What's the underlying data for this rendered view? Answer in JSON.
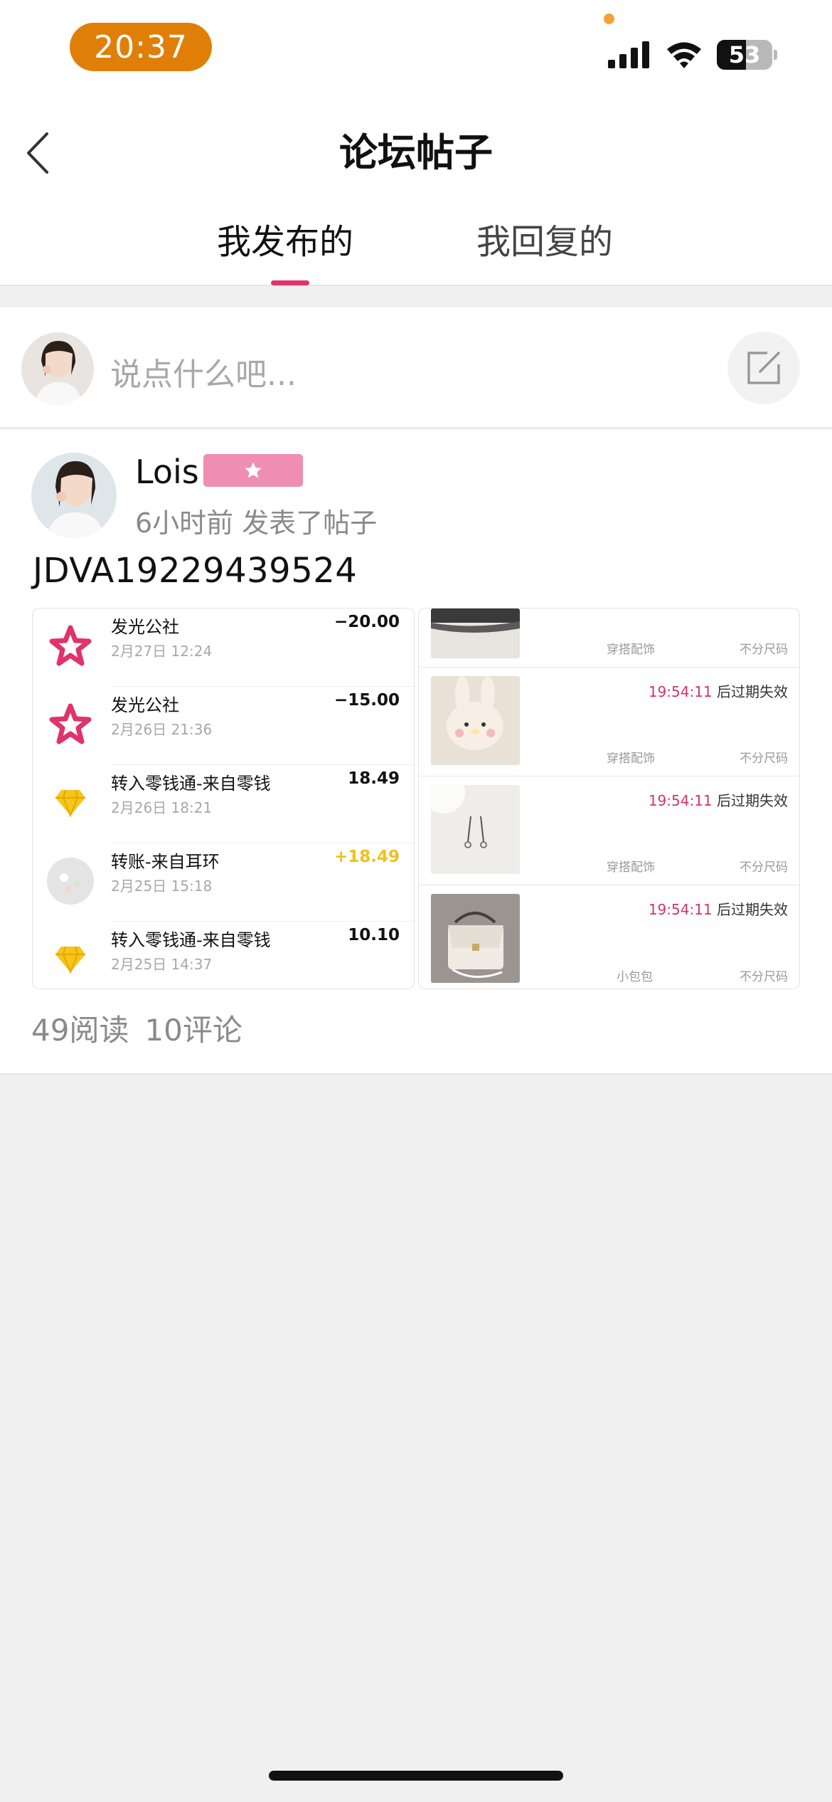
{
  "status_bar": {
    "time": "20:37",
    "battery": "53",
    "battery_level": 0.53
  },
  "nav": {
    "title": "论坛帖子",
    "back_icon": "chevron-left-icon",
    "tabs": [
      {
        "label": "我发布的",
        "active": true
      },
      {
        "label": "我回复的",
        "active": false
      }
    ],
    "accent_color": "#e0336c"
  },
  "compose": {
    "placeholder": "说点什么吧...",
    "edit_icon": "edit-icon"
  },
  "post": {
    "username": "Lois",
    "badge_icon": "star-icon",
    "meta": "6小时前 发表了帖子",
    "content": "JDVA19229439524",
    "transactions": [
      {
        "name": "发光公社",
        "date": "2月27日 12:24",
        "amount": "−20.00",
        "icon": "star-logo-icon",
        "positive": false
      },
      {
        "name": "发光公社",
        "date": "2月26日 21:36",
        "amount": "−15.00",
        "icon": "star-logo-icon",
        "positive": false
      },
      {
        "name": "转入零钱通-来自零钱",
        "date": "2月26日 18:21",
        "amount": "18.49",
        "icon": "diamond-icon",
        "positive": false
      },
      {
        "name": "转账-来自耳环",
        "date": "2月25日 15:18",
        "amount": "+18.49",
        "icon": "avatar-icon",
        "positive": true
      },
      {
        "name": "转入零钱通-来自零钱",
        "date": "2月25日 14:37",
        "amount": "10.10",
        "icon": "diamond-icon",
        "positive": false
      }
    ],
    "listings": [
      {
        "time": "",
        "time_suffix": "",
        "category": "穿搭配饰",
        "size": "不分尺码"
      },
      {
        "time": "19:54:11",
        "time_suffix": " 后过期失效",
        "category": "穿搭配饰",
        "size": "不分尺码"
      },
      {
        "time": "19:54:11",
        "time_suffix": " 后过期失效",
        "category": "穿搭配饰",
        "size": "不分尺码"
      },
      {
        "time": "19:54:11",
        "time_suffix": " 后过期失效",
        "category": "小包包",
        "size": "不分尺码"
      }
    ],
    "reads": "49阅读",
    "comments": "10评论"
  }
}
